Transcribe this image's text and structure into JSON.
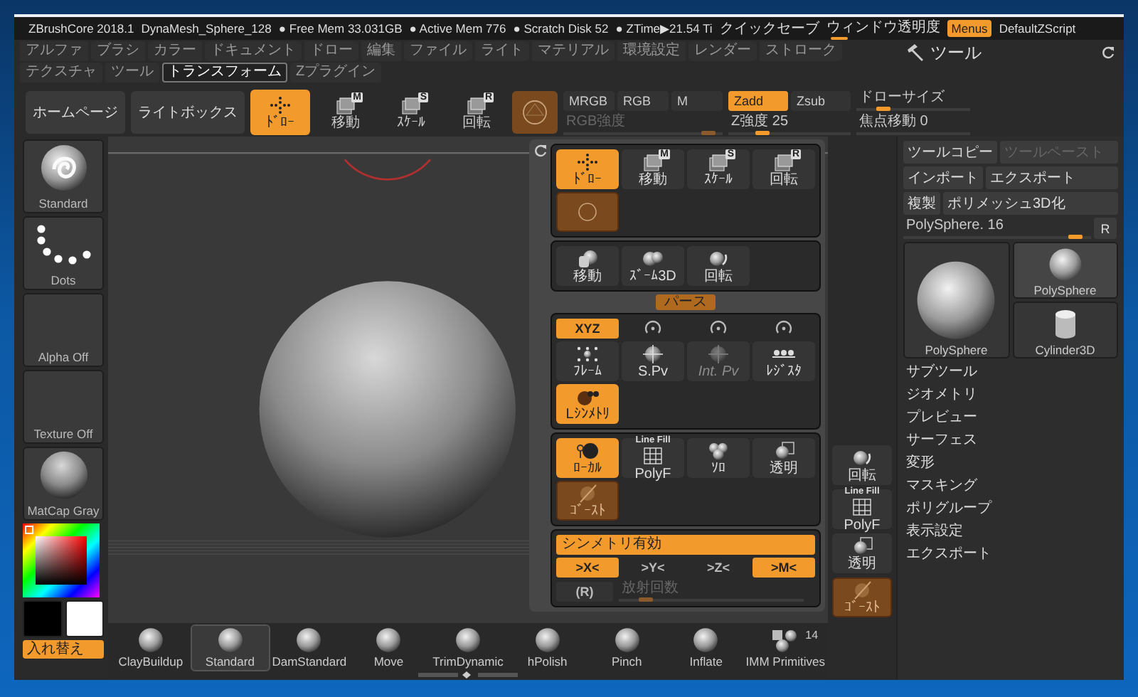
{
  "window": {
    "app": "ZBrushCore 2018.1",
    "document": "DynaMesh_Sphere_128",
    "stats": [
      "● Free Mem 33.031GB",
      "● Active Mem 776",
      "● Scratch Disk 52",
      "● ZTime▶21.54 Ti"
    ],
    "quicksave": "クイックセーブ",
    "transparency": {
      "label": "ウィンドウ透明度",
      "level": 0.05
    },
    "menus": {
      "label": "Menus",
      "on": true
    },
    "script": "DefaultZScript"
  },
  "menubar": [
    {
      "label": "アルファ",
      "selected": false
    },
    {
      "label": "ブラシ",
      "selected": false
    },
    {
      "label": "カラー",
      "selected": false
    },
    {
      "label": "ドキュメント",
      "selected": false
    },
    {
      "label": "ドロー",
      "selected": false
    },
    {
      "label": "編集",
      "selected": false
    },
    {
      "label": "ファイル",
      "selected": false
    },
    {
      "label": "ライト",
      "selected": false
    },
    {
      "label": "マテリアル",
      "selected": false
    },
    {
      "label": "環境設定",
      "selected": false
    },
    {
      "label": "レンダー",
      "selected": false
    },
    {
      "label": "ストローク",
      "selected": false
    },
    {
      "label": "テクスチャ",
      "selected": false
    },
    {
      "label": "ツール",
      "selected": false
    },
    {
      "label": "トランスフォーム",
      "selected": true
    },
    {
      "label": "Zプラグイン",
      "selected": false
    }
  ],
  "toolbar": {
    "buttons": [
      "ホームページ",
      "ライトボックス"
    ],
    "modes": [
      {
        "label": "ﾄﾞﾛｰ",
        "kind": "draw",
        "selected": true
      },
      {
        "label": "移動",
        "kind": "cube",
        "badge": "M",
        "selected": false
      },
      {
        "label": "ｽｹｰﾙ",
        "kind": "cube",
        "badge": "S",
        "selected": false
      },
      {
        "label": "回転",
        "kind": "cube",
        "badge": "R",
        "selected": false
      }
    ],
    "channels": [
      {
        "label": "MRGB",
        "selected": false
      },
      {
        "label": "RGB",
        "selected": false
      },
      {
        "label": "M",
        "selected": false
      }
    ],
    "rgb_slider": {
      "label": "RGB強度",
      "level": 0.95,
      "disabled": true
    },
    "zmodes": [
      {
        "label": "Zadd",
        "selected": true
      },
      {
        "label": "Zsub",
        "selected": false
      }
    ],
    "z_slider": {
      "label": "Z強度 25",
      "level": 0.25,
      "disabled": false
    },
    "side_sliders": [
      {
        "label": "ドローサイズ",
        "level": 0.2,
        "disabled": false
      },
      {
        "label": "焦点移動 0",
        "disabled": false
      }
    ]
  },
  "shelf": {
    "thumbs": [
      {
        "label": "Standard",
        "kind": "brush"
      },
      {
        "label": "Dots",
        "kind": "stroke"
      },
      {
        "label": "Alpha Off",
        "kind": "empty"
      },
      {
        "label": "Texture Off",
        "kind": "empty"
      },
      {
        "label": "MatCap Gray",
        "kind": "matcap"
      }
    ],
    "swatches": [
      {
        "color": "#000000"
      },
      {
        "color": "#ffffff"
      }
    ],
    "swap": "入れ替え"
  },
  "brushes": [
    {
      "label": "ClayBuildup",
      "kind": "sphere",
      "selected": false
    },
    {
      "label": "Standard",
      "kind": "sphere",
      "selected": true
    },
    {
      "label": "DamStandard",
      "kind": "sphere",
      "selected": false
    },
    {
      "label": "Move",
      "kind": "sphere",
      "selected": false
    },
    {
      "label": "TrimDynamic",
      "kind": "sphere",
      "selected": false
    },
    {
      "label": "hPolish",
      "kind": "sphere",
      "selected": false
    },
    {
      "label": "Pinch",
      "kind": "sphere",
      "selected": false
    },
    {
      "label": "Inflate",
      "kind": "sphere",
      "selected": false
    },
    {
      "label": "IMM Primitives",
      "kind": "cluster",
      "count": "14",
      "selected": false
    }
  ],
  "popup": {
    "groups": [
      {
        "kind": "grid",
        "items": [
          {
            "label": "ﾄﾞﾛｰ",
            "kind": "draw",
            "on": true,
            "dimmed": false,
            "disabled": false
          },
          {
            "label": "移動",
            "kind": "cube",
            "badge": "M",
            "on": false,
            "dimmed": false,
            "disabled": false
          },
          {
            "label": "ｽｹｰﾙ",
            "kind": "cube",
            "badge": "S",
            "on": false,
            "dimmed": false,
            "disabled": false
          },
          {
            "label": "回転",
            "kind": "cube",
            "badge": "R",
            "on": false,
            "dimmed": false,
            "disabled": false
          },
          {
            "kind": "material",
            "on": false,
            "dimmed": true,
            "disabled": false
          }
        ]
      },
      {
        "kind": "grid",
        "items": [
          {
            "label": "移動",
            "kind": "hand",
            "on": false,
            "dimmed": false,
            "disabled": false
          },
          {
            "label": "ｽﾞｰﾑ3D",
            "kind": "zoom",
            "on": false,
            "dimmed": false,
            "disabled": false
          },
          {
            "label": "回転",
            "kind": "rotate",
            "on": false,
            "dimmed": false,
            "disabled": false
          }
        ]
      },
      {
        "kind": "axes-grid",
        "tab": "パース",
        "axes": [
          {
            "label": "XYZ",
            "selected": true
          },
          {
            "selected": false
          },
          {
            "selected": false
          },
          {
            "selected": false
          }
        ],
        "items": [
          {
            "label": "ﾌﾚｰﾑ",
            "kind": "frame",
            "on": false,
            "dimmed": false,
            "disabled": false
          },
          {
            "label": "S.Pv",
            "kind": "pivot",
            "on": false,
            "dimmed": false,
            "disabled": false
          },
          {
            "label": "Int. Pv",
            "kind": "pivot",
            "on": false,
            "dimmed": false,
            "disabled": true
          },
          {
            "label": "ﾚｼﾞｽﾀ",
            "kind": "register",
            "on": false,
            "dimmed": false,
            "disabled": false
          },
          {
            "label": "Lｼﾝﾒﾄﾘ",
            "kind": "lsym",
            "on": true,
            "dimmed": false,
            "disabled": false
          }
        ]
      },
      {
        "kind": "grid",
        "items": [
          {
            "label": "ﾛｰｶﾙ",
            "kind": "local",
            "on": true,
            "dimmed": false,
            "disabled": false
          },
          {
            "label": "PolyF",
            "caption": "Line Fill",
            "kind": "polyf",
            "on": false,
            "dimmed": false,
            "disabled": false
          },
          {
            "label": "ｿﾛ",
            "kind": "solo",
            "on": false,
            "dimmed": false,
            "disabled": false
          },
          {
            "label": "透明",
            "kind": "transp",
            "on": false,
            "dimmed": false,
            "disabled": false
          },
          {
            "label": "ｺﾞｰｽﾄ",
            "kind": "ghost",
            "on": false,
            "dimmed": true,
            "disabled": false
          }
        ]
      },
      {
        "kind": "symmetry",
        "toggle": {
          "label": "シンメトリ有効",
          "on": true
        },
        "axes": [
          {
            "label": ">X<",
            "selected": true
          },
          {
            "label": ">Y<",
            "selected": false
          },
          {
            "label": ">Z<",
            "selected": false
          },
          {
            "label": ">M<",
            "selected": true
          }
        ],
        "radial": {
          "label": "(R)",
          "selected": false
        },
        "slider": {
          "label": "放射回数",
          "level": 0.12,
          "disabled": true
        }
      }
    ]
  },
  "right_shelf": [
    {
      "label": "回転",
      "kind": "rotate",
      "on": false,
      "dimmed": false,
      "disabled": false
    },
    {
      "label": "PolyF",
      "caption": "Line Fill",
      "kind": "polyf",
      "on": false,
      "dimmed": false,
      "disabled": false
    },
    {
      "label": "透明",
      "kind": "transp",
      "on": false,
      "dimmed": false,
      "disabled": false
    },
    {
      "label": "ｺﾞｰｽﾄ",
      "kind": "ghost",
      "on": false,
      "dimmed": true,
      "disabled": false
    }
  ],
  "tool": {
    "title": "ツール",
    "buttons": [
      {
        "label": "ツールコピー",
        "disabled": false
      },
      {
        "label": "ツールペースト",
        "disabled": true
      },
      {
        "label": "インポート",
        "disabled": false
      },
      {
        "label": "エクスポート",
        "disabled": false
      },
      {
        "label": "複製",
        "disabled": false
      },
      {
        "label": "ポリメッシュ3D化",
        "disabled": false
      }
    ],
    "slider": {
      "label": "PolySphere. 16",
      "level": 0.95,
      "disabled": false
    },
    "reset": "R",
    "thumbs": [
      {
        "label": "PolySphere",
        "kind": "sphere",
        "selected": false
      },
      {
        "label": "PolySphere",
        "kind": "sphere",
        "selected": true
      },
      {
        "label": "Cylinder3D",
        "kind": "cylinder",
        "selected": false
      }
    ],
    "sections": [
      "サブツール",
      "ジオメトリ",
      "プレビュー",
      "サーフェス",
      "変形",
      "マスキング",
      "ポリグループ",
      "表示設定",
      "エクスポート"
    ]
  }
}
